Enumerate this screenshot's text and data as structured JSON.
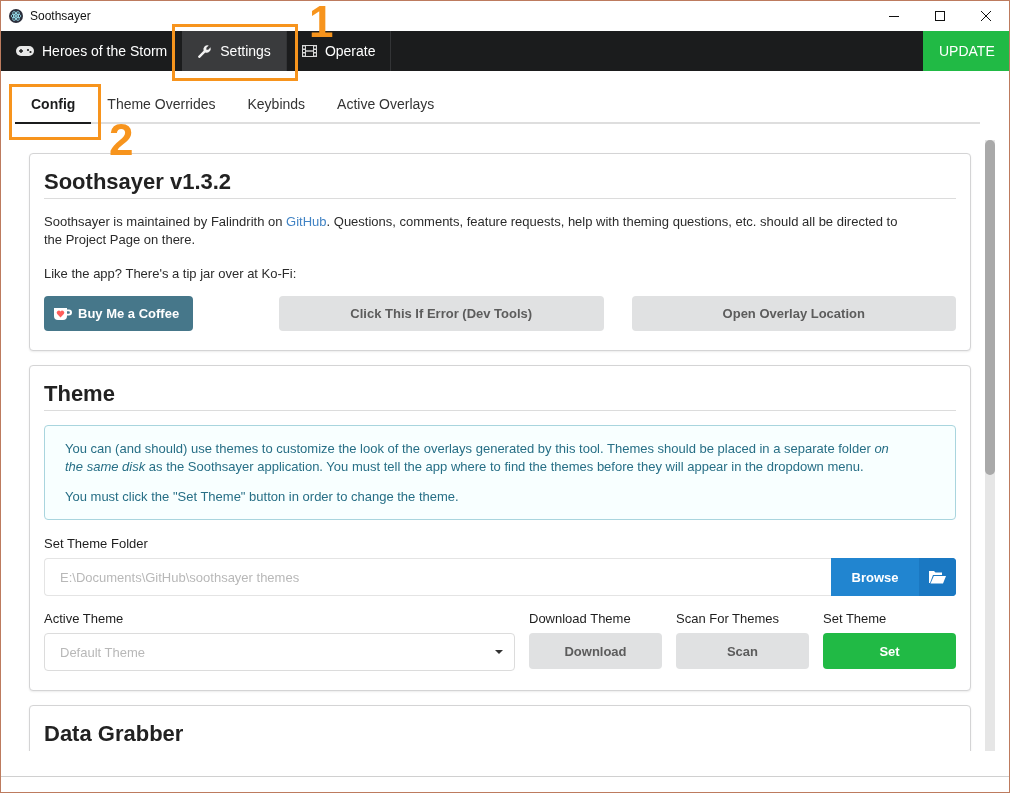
{
  "window": {
    "title": "Soothsayer"
  },
  "nav": {
    "items": [
      {
        "label": "Heroes of the Storm",
        "selected": false
      },
      {
        "label": "Settings",
        "selected": true
      },
      {
        "label": "Operate",
        "selected": false
      }
    ],
    "update_button": "UPDATE"
  },
  "subtabs": [
    {
      "label": "Config",
      "selected": true
    },
    {
      "label": "Theme Overrides",
      "selected": false
    },
    {
      "label": "Keybinds",
      "selected": false
    },
    {
      "label": "Active Overlays",
      "selected": false
    }
  ],
  "about": {
    "title": "Soothsayer v1.3.2",
    "text_before": "Soothsayer is maintained by Falindrith on ",
    "link": "GitHub",
    "text_after": ". Questions, comments, feature requests, help with theming questions, etc. should all be directed to the Project Page on there.",
    "tip": "Like the app? There's a tip jar over at Ko-Fi:",
    "buttons": [
      {
        "label": "Buy Me a Coffee",
        "kind": "kofi"
      },
      {
        "label": "Click This If Error (Dev Tools)",
        "kind": "basic"
      },
      {
        "label": "Open Overlay Location",
        "kind": "basic"
      }
    ]
  },
  "theme": {
    "title": "Theme",
    "info": [
      "You can (and should) use themes to customize the look of the overlays generated by this tool. Themes should be placed in a separate folder *on the same disk* as the Soothsayer application. You must tell the app where to find the themes before they will appear in the dropdown menu.",
      "You must click the \"Set Theme\" button in order to change the theme."
    ],
    "folder_label": "Set Theme Folder",
    "folder_field": {
      "placeholder": "E:\\Documents\\GitHub\\soothsayer themes"
    },
    "browse_button": "Browse",
    "active_label": "Active Theme",
    "active_select": {
      "placeholder": "Default Theme"
    },
    "actions": [
      {
        "label": "Download Theme",
        "button": "Download",
        "kind": "basic"
      },
      {
        "label": "Scan For Themes",
        "button": "Scan",
        "kind": "basic"
      },
      {
        "label": "Set Theme",
        "button": "Set",
        "kind": "positive"
      }
    ]
  },
  "data_grabber": {
    "title": "Data Grabber"
  },
  "callouts": [
    {
      "label": "1"
    },
    {
      "label": "2"
    }
  ]
}
